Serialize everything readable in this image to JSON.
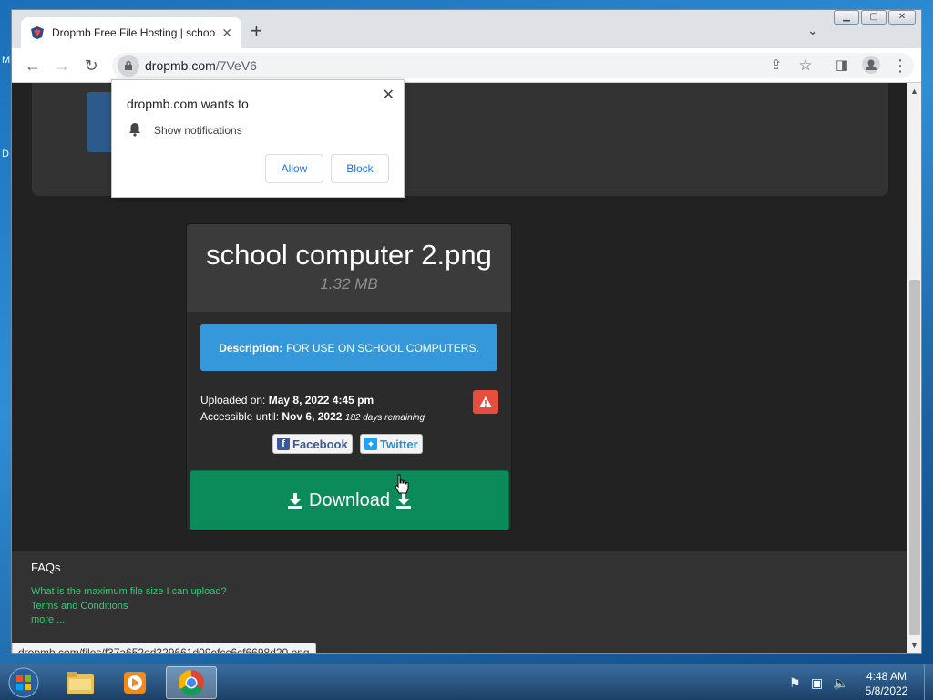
{
  "desktop": {
    "left_chars": [
      "M",
      "D"
    ]
  },
  "browser": {
    "tab_title": "Dropmb Free File Hosting | school",
    "url_host": "dropmb.com",
    "url_path": "/7VeV6"
  },
  "popup": {
    "title": "dropmb.com wants to",
    "permission": "Show notifications",
    "allow_label": "Allow",
    "block_label": "Block"
  },
  "file": {
    "name": "school computer 2.png",
    "size": "1.32 MB",
    "description_label": "Description:",
    "description": "FOR USE ON SCHOOL COMPUTERS.",
    "uploaded_label": "Uploaded on:",
    "uploaded_value": "May 8, 2022 4:45 pm",
    "accessible_label": "Accessible until:",
    "accessible_value": "Nov 6, 2022",
    "remaining": "182 days remaining",
    "facebook_label": "Facebook",
    "twitter_label": "Twitter",
    "download_label": "Download"
  },
  "footer": {
    "faq_title": "FAQs",
    "links": [
      "What is the maximum file size I can upload?",
      "Terms and Conditions",
      "more ..."
    ]
  },
  "status_bar_url": "dropmb.com/files/f37a652ed329661d09efcc6cf6698d20.png",
  "taskbar": {
    "time": "4:48 AM",
    "date": "5/8/2022"
  },
  "colors": {
    "download_green": "#0b8a5a",
    "description_blue": "#3498db",
    "flag_red": "#e74c3c",
    "link_green": "#2ecc71"
  }
}
